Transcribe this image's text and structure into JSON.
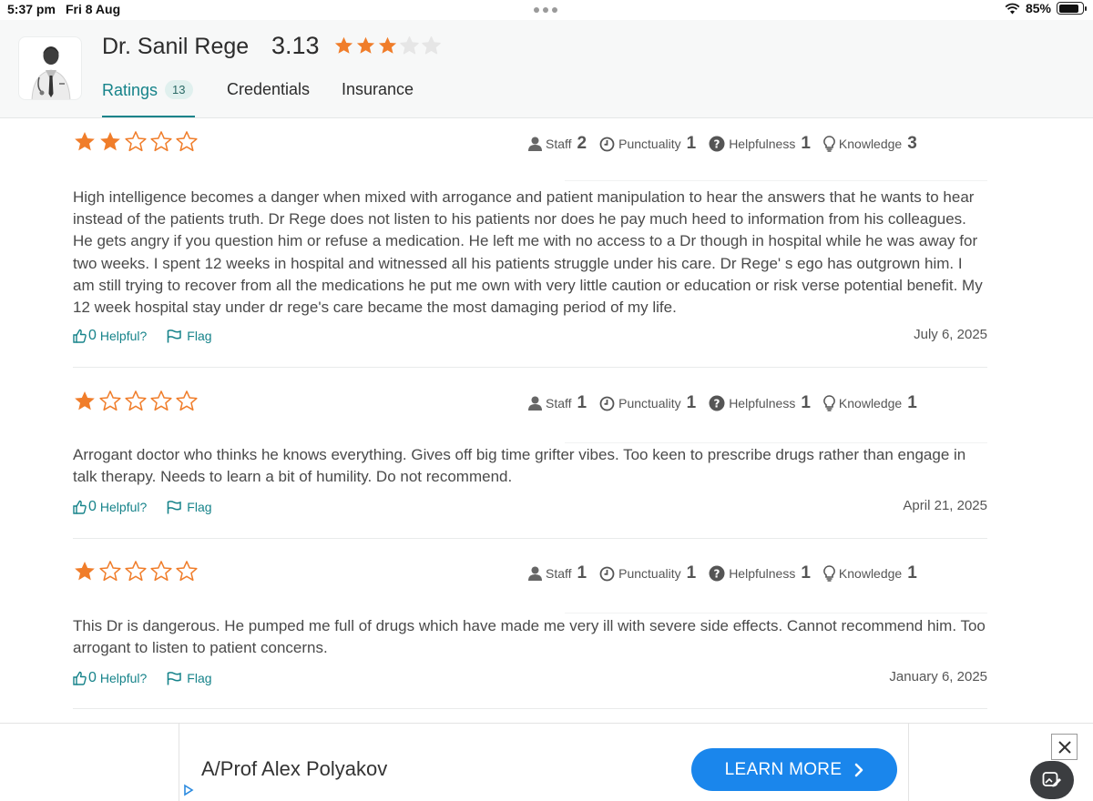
{
  "status_bar": {
    "time": "5:37 pm",
    "date": "Fri 8 Aug",
    "battery_text": "85%",
    "battery_level": 0.85
  },
  "doctor": {
    "name": "Dr. Sanil Rege",
    "rating": "3.13",
    "stars_filled": 3,
    "stars_total": 5
  },
  "tabs": [
    {
      "label": "Ratings",
      "badge": "13",
      "active": true
    },
    {
      "label": "Credentials"
    },
    {
      "label": "Insurance"
    }
  ],
  "metric_labels": {
    "staff": "Staff",
    "punctuality": "Punctuality",
    "helpfulness": "Helpfulness",
    "knowledge": "Knowledge"
  },
  "actions": {
    "helpful_count": "0",
    "helpful_label": "Helpful?",
    "flag_label": "Flag"
  },
  "reviews": [
    {
      "stars": 2,
      "staff": "2",
      "punctuality": "1",
      "helpfulness": "1",
      "knowledge": "3",
      "text": "High intelligence becomes a danger when mixed with arrogance and patient manipulation to hear the answers that he wants to hear instead of the patients truth. Dr Rege does not listen to his patients nor does he pay much heed to information from his colleagues. He gets angry if you question him or refuse a medication. He left me with no access to a Dr though in hospital while he was away for two weeks. I spent 12 weeks in hospital and witnessed all his patients struggle under his care. Dr Rege' s ego has outgrown him. I am still trying to recover from all the medications he put me own with very little caution or education or risk verse potential benefit. My 12 week hospital stay under dr rege's care became the most damaging period of my life.",
      "date": "July 6, 2025"
    },
    {
      "stars": 1,
      "staff": "1",
      "punctuality": "1",
      "helpfulness": "1",
      "knowledge": "1",
      "text": "Arrogant doctor who thinks he knows everything. Gives off big time grifter vibes. Too keen to prescribe drugs rather than engage in talk therapy. Needs to learn a bit of humility. Do not recommend.",
      "date": "April 21, 2025"
    },
    {
      "stars": 1,
      "staff": "1",
      "punctuality": "1",
      "helpfulness": "1",
      "knowledge": "1",
      "text": "This Dr is dangerous. He pumped me full of drugs which have made me very ill with severe side effects. Cannot recommend him. Too arrogant to listen to patient concerns.",
      "date": "January 6, 2025"
    }
  ],
  "ad": {
    "name": "A/Prof Alex Polyakov",
    "button_label": "LEARN MORE",
    "button_color": "#1a86ec"
  },
  "colors": {
    "accent": "#16838a",
    "star": "#f07d2a",
    "star_empty_header": "#e6e6e6"
  }
}
